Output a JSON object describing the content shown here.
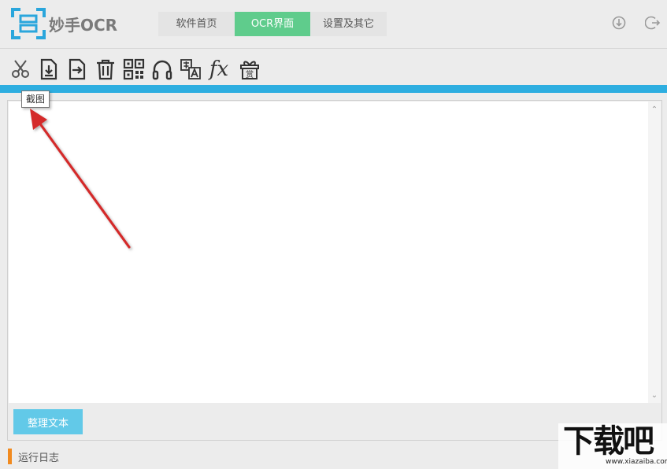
{
  "app": {
    "title": "妙手OCR"
  },
  "tabs": [
    {
      "label": "软件首页"
    },
    {
      "label": "OCR界面"
    },
    {
      "label": "设置及其它"
    }
  ],
  "header_buttons": {
    "update_icon": "download-circle-icon",
    "exit_icon": "exit-icon"
  },
  "toolbar": {
    "items": [
      {
        "icon": "scissors-icon"
      },
      {
        "icon": "file-import-icon"
      },
      {
        "icon": "file-export-icon"
      },
      {
        "icon": "trash-icon"
      },
      {
        "icon": "qrcode-icon"
      },
      {
        "icon": "headphones-icon"
      },
      {
        "icon": "translate-icon"
      },
      {
        "icon": "formula-icon",
        "text": "fx"
      },
      {
        "icon": "reward-gift-icon",
        "text": "赏"
      }
    ],
    "tooltip": "截图"
  },
  "editor": {
    "value": ""
  },
  "buttons": {
    "organize_label": "整理文本"
  },
  "log": {
    "label": "运行日志"
  },
  "watermark": {
    "main": "下载吧",
    "sub": "www.xiazaiba.com"
  },
  "colors": {
    "active_tab": "#5fcc8c",
    "accent_bar": "#2eaee0",
    "button": "#62c9e8",
    "log_marker": "#f18a1f",
    "arrow": "#d42a2a"
  }
}
